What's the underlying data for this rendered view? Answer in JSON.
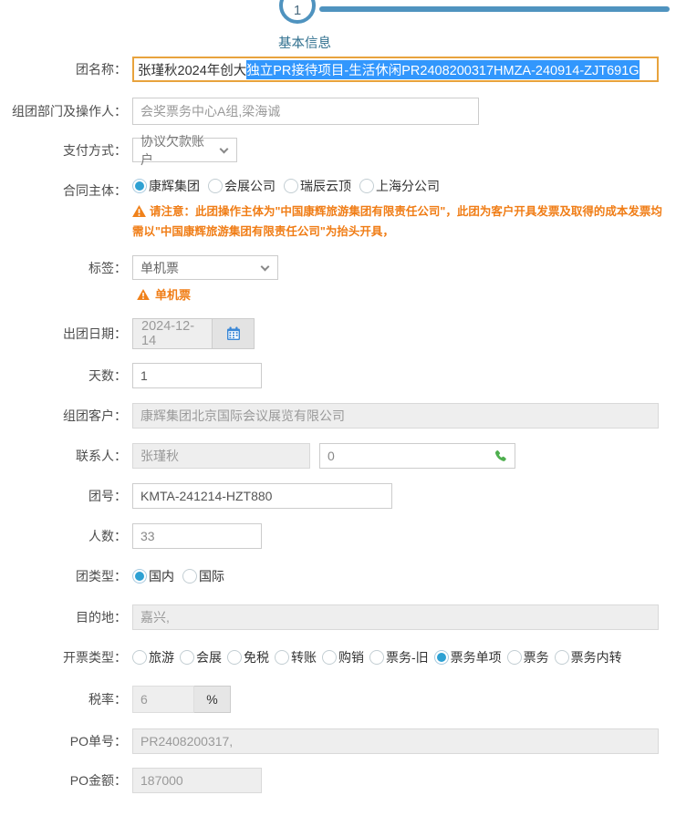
{
  "stepper": {
    "step": "1",
    "title": "基本信息"
  },
  "colors": {
    "accent_blue": "#4f93bf",
    "title_blue": "#31708f",
    "selection_blue": "#3297fd",
    "warning_orange": "#f07d16",
    "radio_blue": "#2ea1d3",
    "phone_green": "#4faf4f",
    "calendar_blue": "#3a87d6",
    "name_border": "#e8a33d"
  },
  "form": {
    "group_name": {
      "label": "团名称：",
      "value_prefix": "张瑾秋2024年创大",
      "value_selected": "独立PR接待项目-生活休闲PR2408200317HMZA-240914-ZJT691G"
    },
    "department": {
      "label": "组团部门及操作人：",
      "value": "会奖票务中心A组,梁海诚"
    },
    "payment_method": {
      "label": "支付方式：",
      "value": "协议欠款账户"
    },
    "contract_entity": {
      "label": "合同主体：",
      "options": [
        "康辉集团",
        "会展公司",
        "瑞辰云顶",
        "上海分公司"
      ],
      "selected": "康辉集团",
      "warning": "请注意：此团操作主体为\"中国康辉旅游集团有限责任公司\"，此团为客户开具发票及取得的成本发票均需以\"中国康辉旅游集团有限责任公司\"为抬头开具，"
    },
    "tag": {
      "label": "标签：",
      "value": "单机票",
      "warning": "单机票"
    },
    "departure_date": {
      "label": "出团日期：",
      "value": "2024-12-14"
    },
    "days": {
      "label": "天数：",
      "value": "1"
    },
    "customer": {
      "label": "组团客户：",
      "value": "康辉集团北京国际会议展览有限公司"
    },
    "contact": {
      "label": "联系人：",
      "name": "张瑾秋",
      "phone": "0"
    },
    "group_no": {
      "label": "团号：",
      "value": "KMTA-241214-HZT880"
    },
    "people_count": {
      "label": "人数：",
      "value": "33"
    },
    "group_type": {
      "label": "团类型：",
      "options": [
        "国内",
        "国际"
      ],
      "selected": "国内"
    },
    "destination": {
      "label": "目的地：",
      "value": "嘉兴,"
    },
    "invoice_type": {
      "label": "开票类型：",
      "options": [
        "旅游",
        "会展",
        "免税",
        "转账",
        "购销",
        "票务-旧",
        "票务单项",
        "票务",
        "票务内转"
      ],
      "selected": "票务单项"
    },
    "tax_rate": {
      "label": "税率：",
      "value": "6",
      "unit": "%"
    },
    "po_no": {
      "label": "PO单号：",
      "value": "PR2408200317,"
    },
    "po_amount": {
      "label": "PO金额：",
      "value": "187000"
    }
  }
}
